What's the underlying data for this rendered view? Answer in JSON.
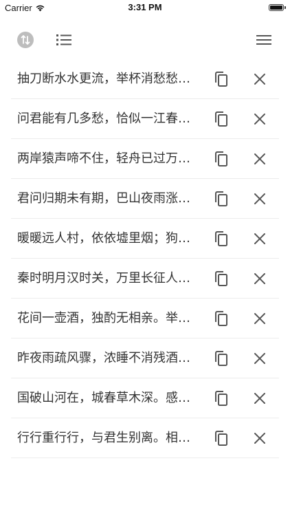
{
  "status_bar": {
    "carrier": "Carrier",
    "time": "3:31 PM",
    "icons": [
      "wifi-icon",
      "battery-icon"
    ]
  },
  "toolbar": {
    "icons": [
      "sort-toggle-icon",
      "list-icon",
      "menu-icon"
    ]
  },
  "poems": [
    {
      "text": "抽刀断水水更流，举杯消愁愁更愁"
    },
    {
      "text": "问君能有几多愁，恰似一江春水向东流"
    },
    {
      "text": "两岸猿声啼不住，轻舟已过万重山"
    },
    {
      "text": "君问归期未有期，巴山夜雨涨秋池"
    },
    {
      "text": "暖暖远人村，依依墟里烟；狗吠深巷中"
    },
    {
      "text": "秦时明月汉时关，万里长征人未还"
    },
    {
      "text": "花间一壶酒，独酌无相亲。举杯邀明月"
    },
    {
      "text": "昨夜雨疏风骤，浓睡不消残酒。试问卷帘人"
    },
    {
      "text": "国破山河在，城春草木深。感时花溅泪"
    },
    {
      "text": "行行重行行，与君生别离。相去万余里"
    }
  ],
  "row_actions": {
    "icons": [
      "copy-icon",
      "close-icon"
    ]
  },
  "colors": {
    "icon": "#555555",
    "divider": "#ececec",
    "text": "#333333"
  }
}
